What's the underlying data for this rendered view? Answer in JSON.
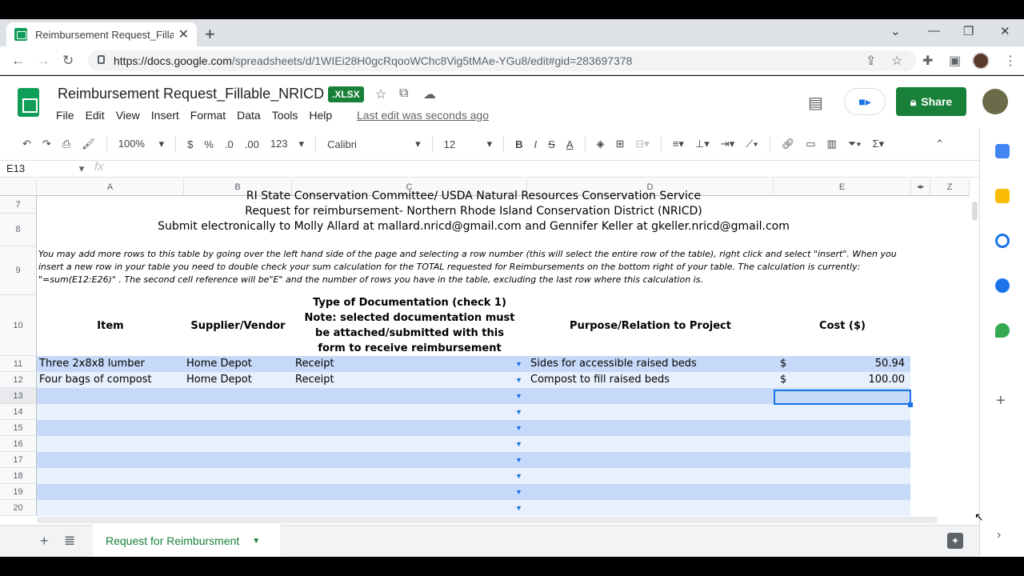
{
  "browser": {
    "tab_title": "Reimbursement Request_Fillable_",
    "url_host": "https://docs.google.com",
    "url_path": "/spreadsheets/d/1WIEi28H0gcRqooWChc8Vig5tMAe-YGu8/edit#gid=283697378"
  },
  "doc": {
    "title": "Reimbursement Request_Fillable_NRICD",
    "badge": ".XLSX",
    "menu": [
      "File",
      "Edit",
      "View",
      "Insert",
      "Format",
      "Data",
      "Tools",
      "Help"
    ],
    "last_edit": "Last edit was seconds ago",
    "share_label": "Share"
  },
  "toolbar": {
    "zoom": "100%",
    "currency": "$",
    "percent": "%",
    "dec_less": ".0",
    "dec_more": ".00",
    "format_more": "123",
    "font": "Calibri",
    "font_size": "12"
  },
  "formula_bar": {
    "name_box": "E13",
    "fx": "fx"
  },
  "columns": [
    "A",
    "B",
    "C",
    "D",
    "E",
    "Z"
  ],
  "rows": [
    "7",
    "8",
    "9",
    "10",
    "11",
    "12",
    "13",
    "14",
    "15",
    "16",
    "17",
    "18",
    "19",
    "20"
  ],
  "sheet": {
    "r6": "RI State Conservation Committee/ USDA Natural Resources Conservation Service",
    "r7": "Request for reimbursement- Northern Rhode Island Conservation District (NRICD)",
    "r8": "Submit electronically to Molly Allard at mallard.nricd@gmail.com and Gennifer Keller at gkeller.nricd@gmail.com",
    "r9": "You may add more rows to this table by going over the  left hand side of the page and selecting a row number (this will select the entire row of the table), right click and select \"insert\". When you insert a new row in your table you need to double check your sum calculation for the TOTAL requested for Reimbursements on the bottom right of your table. The calculation is currently: \"=sum(E12:E26)\" . The second cell reference will be\"E\" and the number of rows you have in the table, excluding the last row where this calculation is.",
    "headers": {
      "item": "Item",
      "supplier": "Supplier/Vendor",
      "doc_type": "Type of Documentation (check 1) Note: selected documentation must be attached/submitted with this form to receive reimbursement",
      "purpose": "Purpose/Relation to Project",
      "cost": "Cost ($)"
    },
    "entries": [
      {
        "item": "Three 2x8x8 lumber",
        "supplier": "Home Depot",
        "doc": "Receipt",
        "purpose": "Sides for accessible raised beds",
        "cur": "$",
        "cost": "50.94"
      },
      {
        "item": "Four bags of compost",
        "supplier": "Home Depot",
        "doc": "Receipt",
        "purpose": "Compost to fill raised beds",
        "cur": "$",
        "cost": "100.00"
      }
    ]
  },
  "sheet_tab": "Request for Reimbursment",
  "colors": {
    "band_dark": "#c6d9f8",
    "band_light": "#e8f0fe",
    "accent": "#188038",
    "selection": "#1a73e8"
  }
}
